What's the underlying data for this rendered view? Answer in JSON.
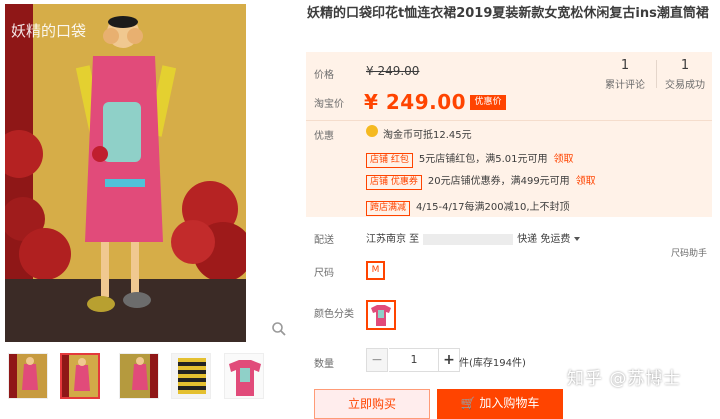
{
  "product": {
    "title": "妖精的口袋印花t恤连衣裙2019夏装新款女宽松休闲复古ins潮直筒裙",
    "brand_overlay": "妖精的口袋"
  },
  "price": {
    "label_price": "价格",
    "original": "¥ 249.00",
    "label_taobao": "淘宝价",
    "current": "¥ 249.00",
    "sale_tag": "优惠价"
  },
  "stats": [
    {
      "count": "1",
      "label": "累计评论"
    },
    {
      "count": "1",
      "label": "交易成功"
    }
  ],
  "discount": {
    "label": "优惠",
    "coin_text": "淘金币可抵12.45元",
    "promos": [
      {
        "tag": "店铺 红包",
        "text": "5元店铺红包，满5.01元可用",
        "link": "领取"
      },
      {
        "tag": "店铺 优惠券",
        "text": "20元店铺优惠券，满499元可用",
        "link": "领取"
      },
      {
        "tag": "跨店满减",
        "text": "4/15-4/17每满200减10,上不封顶",
        "link": ""
      }
    ]
  },
  "delivery": {
    "label": "配送",
    "from": "江苏南京 至",
    "method": "快递 免运费"
  },
  "size": {
    "label": "尺码",
    "helper": "尺码助手",
    "selected": "M"
  },
  "color": {
    "label": "颜色分类"
  },
  "quantity": {
    "label": "数量",
    "minus": "−",
    "value": "1",
    "plus": "+",
    "stock": "件(库存194件)"
  },
  "actions": {
    "buy_now": "立即购买",
    "add_cart": "加入购物车"
  },
  "watermark": "知乎 @苏博士",
  "colors": {
    "accent": "#ff4400",
    "price_bg": "#fff2e8"
  },
  "icons": [
    "zoom-icon",
    "coin-icon",
    "caret-down-icon",
    "cart-icon"
  ]
}
